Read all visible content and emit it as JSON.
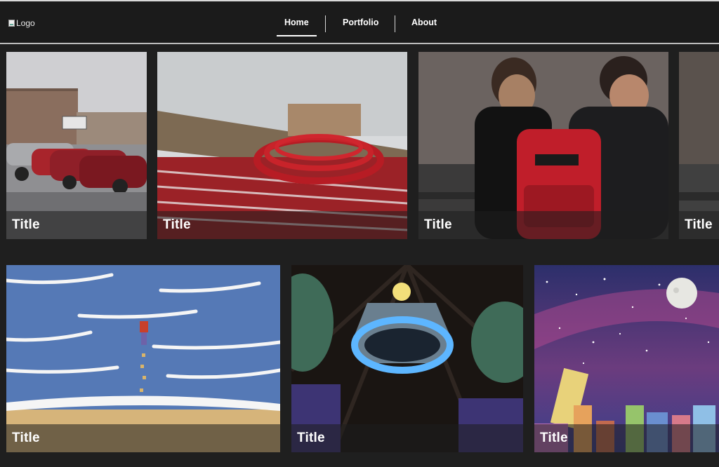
{
  "header": {
    "logo_alt": "Logo",
    "nav": [
      {
        "label": "Home",
        "active": true
      },
      {
        "label": "Portfolio",
        "active": false
      },
      {
        "label": "About",
        "active": false
      }
    ]
  },
  "gallery": {
    "row1": [
      {
        "title": "Title",
        "subject": "parking lot with red cars"
      },
      {
        "title": "Title",
        "subject": "red hoses in snow"
      },
      {
        "title": "Title",
        "subject": "people with red backpack"
      },
      {
        "title": "Title",
        "subject": "cropped photo"
      }
    ],
    "row2": [
      {
        "title": "Title",
        "subject": "beach waves illustration"
      },
      {
        "title": "Title",
        "subject": "glowing monster illustration"
      },
      {
        "title": "Title",
        "subject": "night city illustration"
      }
    ]
  },
  "colors": {
    "background": "#1f1f1f",
    "header": "#1b1b1b",
    "text": "#ffffff"
  }
}
